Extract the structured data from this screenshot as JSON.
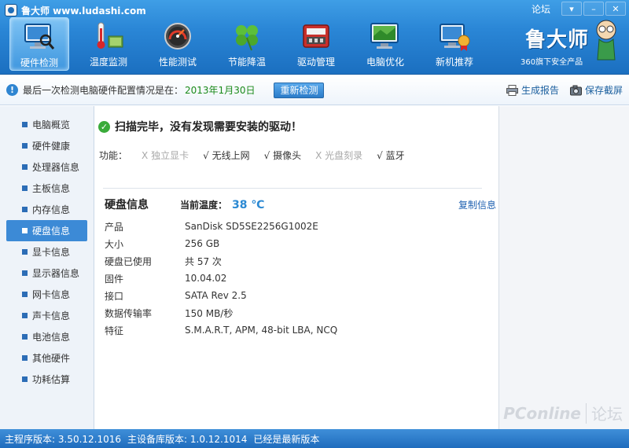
{
  "window": {
    "title": "鲁大师 www.ludashi.com",
    "forum_link": "论坛",
    "controls": [
      "▾",
      "–",
      "✕"
    ]
  },
  "nav": {
    "items": [
      {
        "label": "硬件检测",
        "icon": "monitor-magnifier-icon",
        "active": true
      },
      {
        "label": "温度监测",
        "icon": "thermometer-icon",
        "active": false
      },
      {
        "label": "性能测试",
        "icon": "speedometer-icon",
        "active": false
      },
      {
        "label": "节能降温",
        "icon": "clover-icon",
        "active": false
      },
      {
        "label": "驱动管理",
        "icon": "driver-box-icon",
        "active": false
      },
      {
        "label": "电脑优化",
        "icon": "optimize-monitor-icon",
        "active": false
      },
      {
        "label": "新机推荐",
        "icon": "new-pc-icon",
        "active": false
      }
    ]
  },
  "brand": {
    "name": "鲁大师",
    "subtitle": "360旗下安全产品"
  },
  "infobar": {
    "text": "最后一次检测电脑硬件配置情况是在：",
    "date": "2013年1月30日",
    "recheck_label": "重新检测",
    "report_label": "生成报告",
    "screenshot_label": "保存截屏"
  },
  "sidebar": {
    "items": [
      {
        "label": "电脑概览",
        "active": false
      },
      {
        "label": "硬件健康",
        "active": false
      },
      {
        "label": "处理器信息",
        "active": false
      },
      {
        "label": "主板信息",
        "active": false
      },
      {
        "label": "内存信息",
        "active": false
      },
      {
        "label": "硬盘信息",
        "active": true
      },
      {
        "label": "显卡信息",
        "active": false
      },
      {
        "label": "显示器信息",
        "active": false
      },
      {
        "label": "网卡信息",
        "active": false
      },
      {
        "label": "声卡信息",
        "active": false
      },
      {
        "label": "电池信息",
        "active": false
      },
      {
        "label": "其他硬件",
        "active": false
      },
      {
        "label": "功耗估算",
        "active": false
      }
    ]
  },
  "main": {
    "scan_message": "扫描完毕，没有发现需要安装的驱动！",
    "features_label": "功能：",
    "features": [
      {
        "mark": "X",
        "label": "独立显卡",
        "enabled": false
      },
      {
        "mark": "√",
        "label": "无线上网",
        "enabled": true
      },
      {
        "mark": "√",
        "label": "摄像头",
        "enabled": true
      },
      {
        "mark": "X",
        "label": "光盘刻录",
        "enabled": false
      },
      {
        "mark": "√",
        "label": "蓝牙",
        "enabled": true
      }
    ],
    "disk": {
      "title": "硬盘信息",
      "temp_label": "当前温度：",
      "temp_value": "38 ℃",
      "copy_label": "复制信息",
      "rows": [
        {
          "key": "产品",
          "value": "SanDisk SD5SE2256G1002E"
        },
        {
          "key": "大小",
          "value": "256 GB"
        },
        {
          "key": "硬盘已使用",
          "value": "共 57 次"
        },
        {
          "key": "固件",
          "value": "10.04.02"
        },
        {
          "key": "接口",
          "value": "SATA Rev 2.5"
        },
        {
          "key": "数据传输率",
          "value": "150 MB/秒"
        },
        {
          "key": "特征",
          "value": "S.M.A.R.T,  APM,  48-bit LBA,  NCQ"
        }
      ]
    }
  },
  "watermark": {
    "logo": "PConline",
    "forum": "论坛"
  },
  "status": {
    "main_version": "主程序版本: 3.50.12.1016",
    "db_version": "主设备库版本: 1.0.12.1014",
    "latest": "已经是最新版本"
  },
  "colors": {
    "header_blue": "#2a86d6",
    "temp_blue": "#2b89d3",
    "date_green": "#1a8a1a",
    "sidebar_active": "#3c8ad6"
  }
}
